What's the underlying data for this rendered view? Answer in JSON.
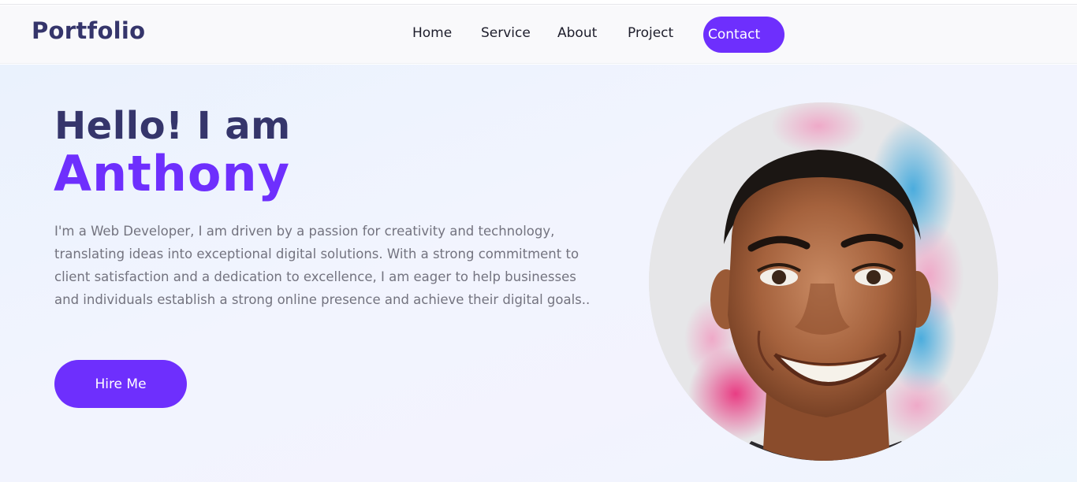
{
  "header": {
    "logo": "Portfolio",
    "nav": [
      {
        "label": "Home"
      },
      {
        "label": "Service"
      },
      {
        "label": "About"
      },
      {
        "label": "Project"
      }
    ],
    "contact_label": "Contact"
  },
  "hero": {
    "greeting": "Hello! I am",
    "name": "Anthony",
    "bio": "I'm a Web Developer, I am driven by a passion for creativity and technology, translating ideas into exceptional digital solutions. With a strong commitment to client satisfaction and a dedication to excellence, I am eager to help businesses and individuals establish a strong online presence and achieve their digital goals..",
    "hire_label": "Hire Me"
  },
  "colors": {
    "accent": "#6e2ffd",
    "heading": "#35356b",
    "body_text": "#73737f"
  },
  "icons": {
    "portrait": "avatar-illustration"
  }
}
